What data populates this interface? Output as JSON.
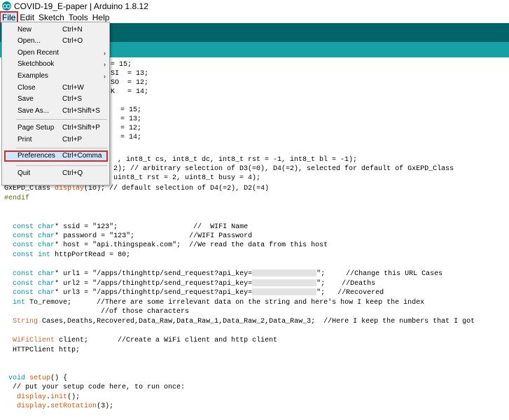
{
  "window": {
    "title": "COVID-19_E-paper | Arduino 1.8.12"
  },
  "menubar": [
    "File",
    "Edit",
    "Sketch",
    "Tools",
    "Help"
  ],
  "file_menu": [
    {
      "label": "New",
      "shortcut": "Ctrl+N"
    },
    {
      "label": "Open...",
      "shortcut": "Ctrl+O"
    },
    {
      "label": "Open Recent",
      "shortcut": "",
      "submenu": true
    },
    {
      "label": "Sketchbook",
      "shortcut": "",
      "submenu": true
    },
    {
      "label": "Examples",
      "shortcut": "",
      "submenu": true
    },
    {
      "label": "Close",
      "shortcut": "Ctrl+W"
    },
    {
      "label": "Save",
      "shortcut": "Ctrl+S"
    },
    {
      "label": "Save As...",
      "shortcut": "Ctrl+Shift+S"
    },
    {
      "label": "Page Setup",
      "shortcut": "Ctrl+Shift+P"
    },
    {
      "label": "Print",
      "shortcut": "Ctrl+P"
    },
    {
      "label": "Preferences",
      "shortcut": "Ctrl+Comma"
    },
    {
      "label": "Quit",
      "shortcut": "Ctrl+Q"
    }
  ],
  "code": [
    {
      "tokens": [
        {
          "t": "= 15;",
          "c": ""
        }
      ]
    },
    {
      "tokens": [
        {
          "t": "SI  = 13;",
          "c": ""
        }
      ]
    },
    {
      "tokens": [
        {
          "t": "SO  = 12;",
          "c": ""
        }
      ]
    },
    {
      "tokens": [
        {
          "t": "K   = 14;",
          "c": ""
        }
      ]
    },
    {
      "tokens": [
        {
          "t": "",
          "c": ""
        }
      ]
    },
    {
      "tokens": [
        {
          "t": "= 15;",
          "c": ""
        }
      ]
    },
    {
      "tokens": [
        {
          "t": "= 13;",
          "c": ""
        }
      ]
    },
    {
      "tokens": [
        {
          "t": "= 12;",
          "c": ""
        }
      ]
    },
    {
      "tokens": [
        {
          "t": "= 14;",
          "c": ""
        }
      ]
    },
    {
      "tokens": [
        {
          "t": "",
          "c": ""
        }
      ]
    },
    {
      "tokens": [
        {
          "t": ", int8_t cs, int8_t dc, int8_t rst = -1, int8_t bl = -1);",
          "c": ""
        }
      ]
    },
    {
      "tokens": [
        {
          "t": "2); // arbitrary selection of D3(=0), D4(=2), selected for default of GxEPD_Class",
          "c": ""
        }
      ]
    },
    {
      "tokens": [
        {
          "t": "uint8_t rst = 2, uint8_t busy = 4);",
          "c": ""
        }
      ]
    },
    {
      "tokens": [
        {
          "t": "GxEPD_Class ",
          "c": ""
        },
        {
          "t": "display",
          "c": "fn"
        },
        {
          "t": "(io); // default selection of D4(=2), D2(=4)",
          "c": ""
        }
      ]
    },
    {
      "tokens": [
        {
          "t": "#endif",
          "c": "pp"
        }
      ]
    },
    {
      "tokens": [
        {
          "t": "",
          "c": ""
        }
      ]
    },
    {
      "tokens": [
        {
          "t": "",
          "c": ""
        }
      ]
    },
    {
      "tokens": [
        {
          "t": "  ",
          "c": ""
        },
        {
          "t": "const",
          "c": "kw"
        },
        {
          "t": " ",
          "c": ""
        },
        {
          "t": "char",
          "c": "kw"
        },
        {
          "t": "* ssid = \"123\";                  //  WIFI Name",
          "c": ""
        }
      ]
    },
    {
      "tokens": [
        {
          "t": "  ",
          "c": ""
        },
        {
          "t": "const",
          "c": "kw"
        },
        {
          "t": " ",
          "c": ""
        },
        {
          "t": "char",
          "c": "kw"
        },
        {
          "t": "* password = \"123\";             //WIFI Password",
          "c": ""
        }
      ]
    },
    {
      "tokens": [
        {
          "t": "  ",
          "c": ""
        },
        {
          "t": "const",
          "c": "kw"
        },
        {
          "t": " ",
          "c": ""
        },
        {
          "t": "char",
          "c": "kw"
        },
        {
          "t": "* host = \"api.thingspeak.com\";  //We read the data from this host",
          "c": ""
        }
      ]
    },
    {
      "tokens": [
        {
          "t": "  ",
          "c": ""
        },
        {
          "t": "const",
          "c": "kw"
        },
        {
          "t": " ",
          "c": ""
        },
        {
          "t": "int",
          "c": "kw"
        },
        {
          "t": " httpPortRead = 80;",
          "c": ""
        }
      ]
    },
    {
      "tokens": [
        {
          "t": "",
          "c": ""
        }
      ]
    },
    {
      "tokens": [
        {
          "t": "  ",
          "c": ""
        },
        {
          "t": "const",
          "c": "kw"
        },
        {
          "t": " ",
          "c": ""
        },
        {
          "t": "char",
          "c": "kw"
        },
        {
          "t": "* url1 = \"/apps/thinghttp/send_request?api_key=",
          "c": ""
        },
        {
          "t": "BLUR",
          "c": "blur"
        },
        {
          "t": "\";     //Change this URL Cases",
          "c": ""
        }
      ]
    },
    {
      "tokens": [
        {
          "t": "  ",
          "c": ""
        },
        {
          "t": "const",
          "c": "kw"
        },
        {
          "t": " ",
          "c": ""
        },
        {
          "t": "char",
          "c": "kw"
        },
        {
          "t": "* url2 = \"/apps/thinghttp/send_request?api_key=",
          "c": ""
        },
        {
          "t": "BLUR",
          "c": "blur"
        },
        {
          "t": "\";    //Deaths",
          "c": ""
        }
      ]
    },
    {
      "tokens": [
        {
          "t": "  ",
          "c": ""
        },
        {
          "t": "const",
          "c": "kw"
        },
        {
          "t": " ",
          "c": ""
        },
        {
          "t": "char",
          "c": "kw"
        },
        {
          "t": "* url3 = \"/apps/thinghttp/send_request?api_key=",
          "c": ""
        },
        {
          "t": "BLUR",
          "c": "blur"
        },
        {
          "t": "\";   //Recovered",
          "c": ""
        }
      ]
    },
    {
      "tokens": [
        {
          "t": "  ",
          "c": ""
        },
        {
          "t": "int",
          "c": "kw"
        },
        {
          "t": " To_remove;      //There are some irrelevant data on the string and here's how I keep the index",
          "c": ""
        }
      ]
    },
    {
      "tokens": [
        {
          "t": "                       //of those characters",
          "c": ""
        }
      ]
    },
    {
      "tokens": [
        {
          "t": "  ",
          "c": ""
        },
        {
          "t": "String",
          "c": "ty"
        },
        {
          "t": " Cases,Deaths,Recovered,Data_Raw,Data_Raw_1,Data_Raw_2,Data_Raw_3;  //Here I keep the numbers that I got",
          "c": ""
        }
      ]
    },
    {
      "tokens": [
        {
          "t": "",
          "c": ""
        }
      ]
    },
    {
      "tokens": [
        {
          "t": "  ",
          "c": ""
        },
        {
          "t": "WiFiClient",
          "c": "ty"
        },
        {
          "t": " client;       //Create a WiFi client and http client",
          "c": ""
        }
      ]
    },
    {
      "tokens": [
        {
          "t": "  HTTPClient http;",
          "c": ""
        }
      ]
    },
    {
      "tokens": [
        {
          "t": "",
          "c": ""
        }
      ]
    },
    {
      "tokens": [
        {
          "t": "",
          "c": ""
        }
      ]
    },
    {
      "tokens": [
        {
          "t": " ",
          "c": ""
        },
        {
          "t": "void",
          "c": "kw"
        },
        {
          "t": " ",
          "c": ""
        },
        {
          "t": "setup",
          "c": "fn"
        },
        {
          "t": "() {",
          "c": ""
        }
      ]
    },
    {
      "tokens": [
        {
          "t": "  // put your setup code here, to run once:",
          "c": ""
        }
      ]
    },
    {
      "tokens": [
        {
          "t": "   ",
          "c": ""
        },
        {
          "t": "display",
          "c": "fn"
        },
        {
          "t": ".",
          "c": ""
        },
        {
          "t": "init",
          "c": "fn"
        },
        {
          "t": "();",
          "c": ""
        }
      ]
    },
    {
      "tokens": [
        {
          "t": "   ",
          "c": ""
        },
        {
          "t": "display",
          "c": "fn"
        },
        {
          "t": ".",
          "c": ""
        },
        {
          "t": "setRotation",
          "c": "fn"
        },
        {
          "t": "(3);",
          "c": ""
        }
      ]
    }
  ]
}
